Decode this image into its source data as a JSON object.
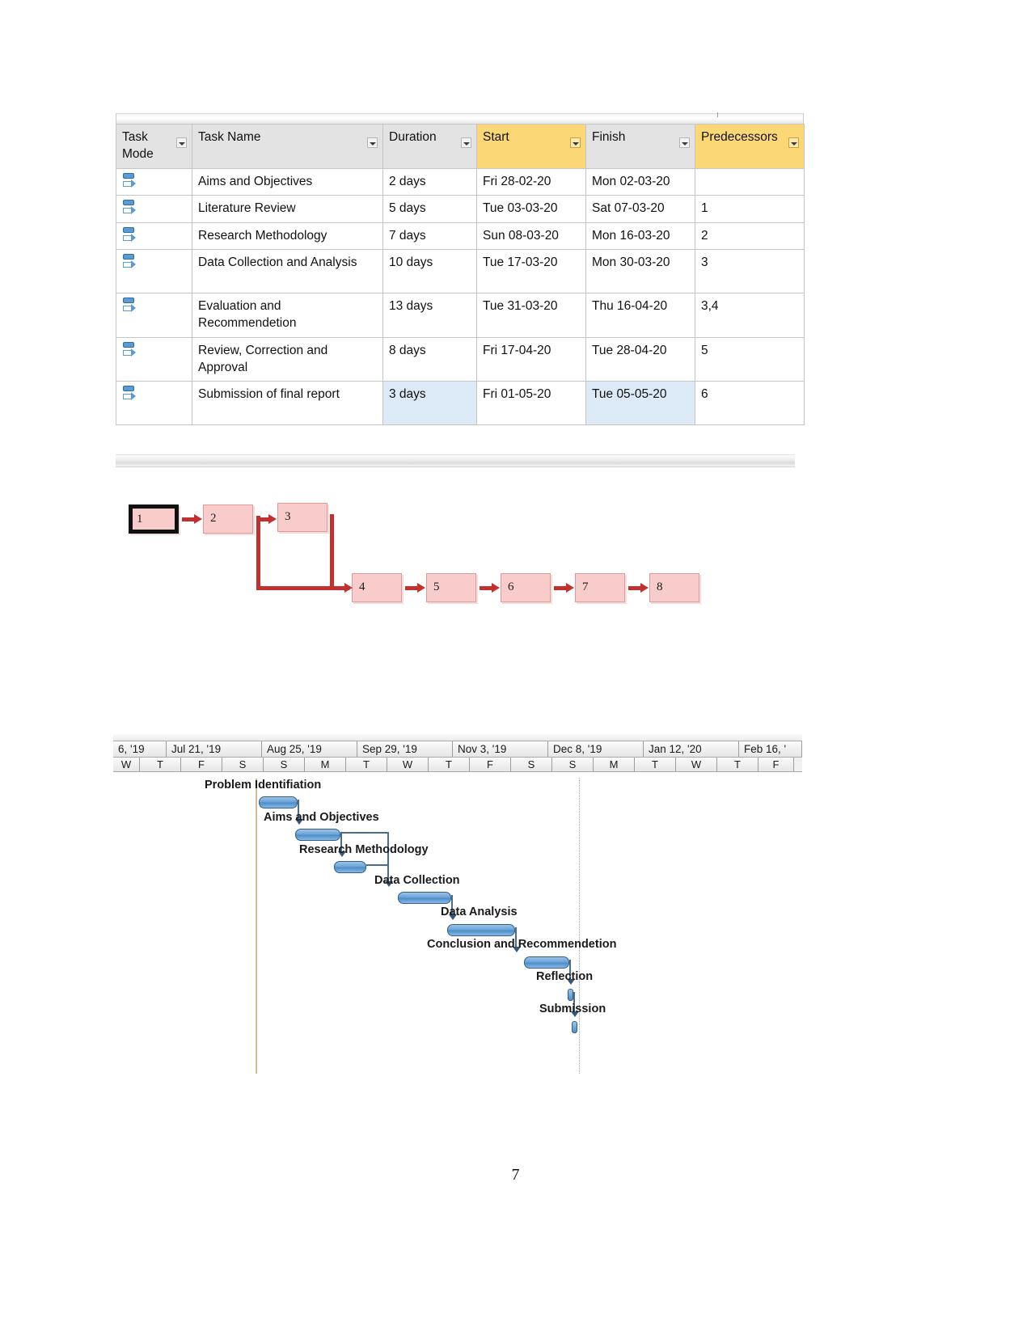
{
  "document": {
    "page_number": "7"
  },
  "task_table": {
    "columns": [
      {
        "label": "Task Mode",
        "highlight": false
      },
      {
        "label": "Task Name",
        "highlight": false
      },
      {
        "label": "Duration",
        "highlight": false
      },
      {
        "label": "Start",
        "highlight": true
      },
      {
        "label": "Finish",
        "highlight": false
      },
      {
        "label": "Predecessors",
        "highlight": true
      }
    ],
    "rows": [
      {
        "mode_icon": "manually-scheduled-icon",
        "name": "Aims and Objectives",
        "duration": "2 days",
        "start": "Fri 28-02-20",
        "finish": "Mon 02-03-20",
        "predecessors": ""
      },
      {
        "mode_icon": "manually-scheduled-icon",
        "name": "Literature Review",
        "duration": "5 days",
        "start": "Tue 03-03-20",
        "finish": "Sat 07-03-20",
        "predecessors": "1"
      },
      {
        "mode_icon": "manually-scheduled-icon",
        "name": "Research Methodology",
        "duration": "7 days",
        "start": "Sun 08-03-20",
        "finish": "Mon 16-03-20",
        "predecessors": "2"
      },
      {
        "mode_icon": "manually-scheduled-icon",
        "name": "Data Collection and Analysis",
        "duration": "10 days",
        "start": "Tue 17-03-20",
        "finish": "Mon 30-03-20",
        "predecessors": "3"
      },
      {
        "mode_icon": "manually-scheduled-icon",
        "name": "Evaluation and Recommendetion",
        "duration": "13 days",
        "start": "Tue 31-03-20",
        "finish": "Thu 16-04-20",
        "predecessors": "3,4"
      },
      {
        "mode_icon": "manually-scheduled-icon",
        "name": "Review, Correction and Approval",
        "duration": "8 days",
        "start": "Fri 17-04-20",
        "finish": "Tue 28-04-20",
        "predecessors": "5"
      },
      {
        "mode_icon": "manually-scheduled-icon",
        "name": "Submission of final report",
        "duration": "3 days",
        "start": "Fri 01-05-20",
        "finish": "Tue 05-05-20",
        "predecessors": "6",
        "selected": true
      }
    ],
    "colors": {
      "header_background": "#e3e3e3",
      "header_highlight": "#fbd776",
      "selection": "#dce9f7",
      "grid": "#c5c5c5"
    }
  },
  "network_diagram": {
    "node_fill": "#f9cccc",
    "node_border": "#e59a9a",
    "link_color": "#c23030",
    "critical_border": "#111111",
    "nodes": [
      {
        "id": "1",
        "critical": true
      },
      {
        "id": "2",
        "critical": false
      },
      {
        "id": "3",
        "critical": false
      },
      {
        "id": "4",
        "critical": false
      },
      {
        "id": "5",
        "critical": false
      },
      {
        "id": "6",
        "critical": false
      },
      {
        "id": "7",
        "critical": false
      },
      {
        "id": "8",
        "critical": false
      }
    ],
    "links": [
      "1-2",
      "2-3",
      "2-4",
      "3-4",
      "4-5",
      "5-6",
      "6-7",
      "7-8"
    ]
  },
  "gantt": {
    "timeline": {
      "months": [
        "6, '19",
        "Jul 21, '19",
        "Aug 25, '19",
        "Sep 29, '19",
        "Nov 3, '19",
        "Dec 8, '19",
        "Jan 12, '20",
        "Feb 16, '"
      ],
      "days": [
        "W",
        "T",
        "F",
        "S",
        "S",
        "M",
        "T",
        "W",
        "T",
        "F",
        "S",
        "S",
        "M",
        "T",
        "W",
        "T",
        "F"
      ]
    },
    "bar_color": "#4d8ec9",
    "link_color": "#4a6d8c",
    "tasks": [
      {
        "label": "Problem Identifiation",
        "type": "bar"
      },
      {
        "label": "Aims and Objectives",
        "type": "bar"
      },
      {
        "label": "Research Methodology",
        "type": "bar"
      },
      {
        "label": "Data Collection",
        "type": "bar"
      },
      {
        "label": "Data Analysis",
        "type": "bar"
      },
      {
        "label": "Conclusion and Recommendetion",
        "type": "bar"
      },
      {
        "label": "Reflection",
        "type": "milestone"
      },
      {
        "label": "Submission",
        "type": "milestone"
      }
    ]
  }
}
